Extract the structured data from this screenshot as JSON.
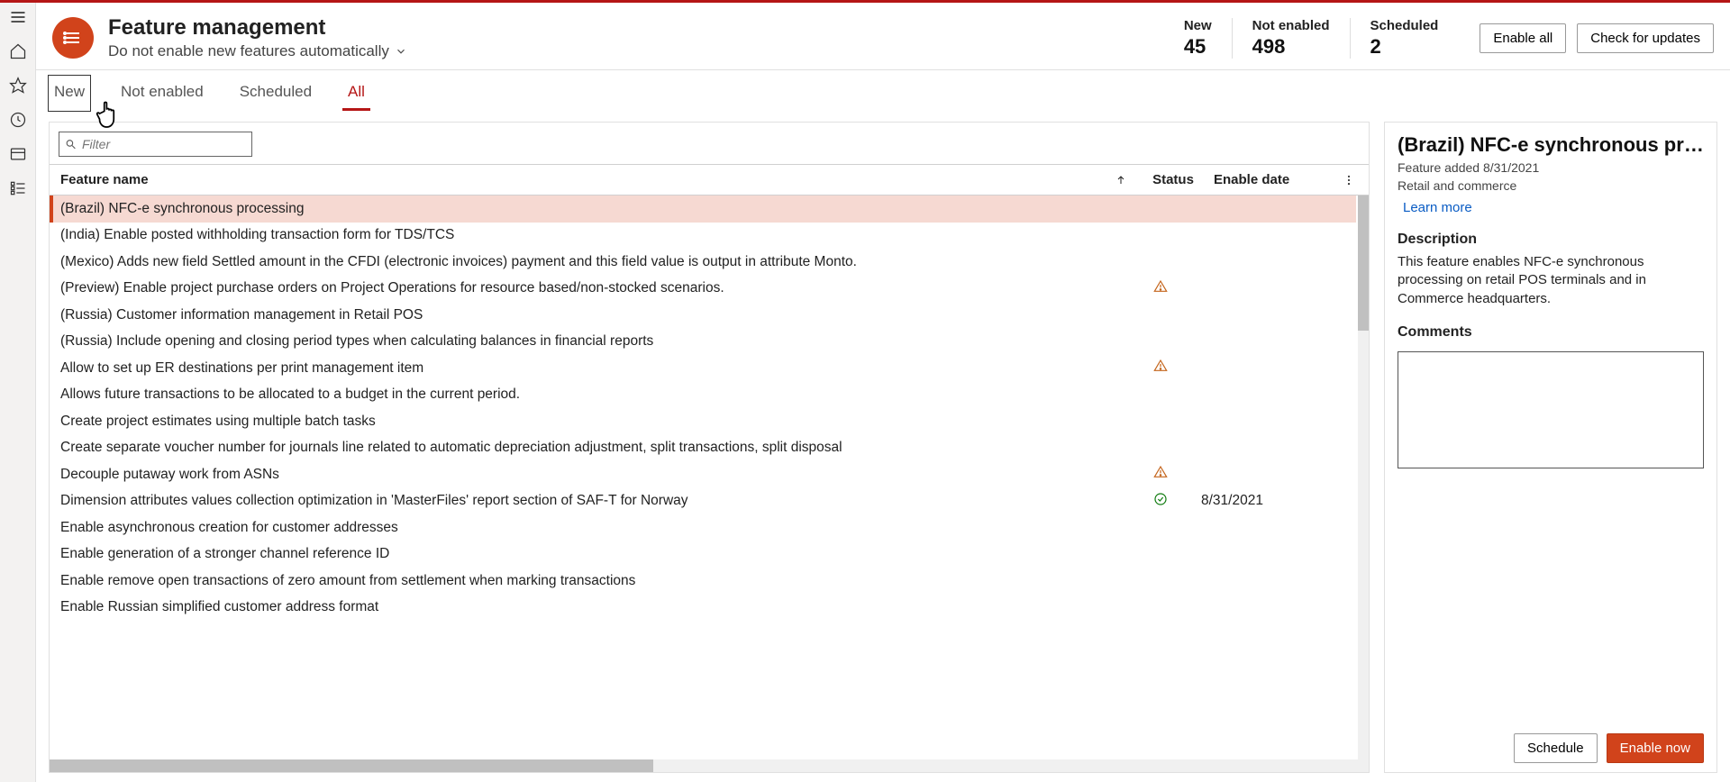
{
  "header": {
    "title": "Feature management",
    "subtitle": "Do not enable new features automatically",
    "metrics": [
      {
        "label": "New",
        "value": "45"
      },
      {
        "label": "Not enabled",
        "value": "498"
      },
      {
        "label": "Scheduled",
        "value": "2"
      }
    ],
    "actions": {
      "enable_all": "Enable all",
      "check_updates": "Check for updates"
    }
  },
  "tabs": {
    "new": "New",
    "not_enabled": "Not enabled",
    "scheduled": "Scheduled",
    "all": "All"
  },
  "filter": {
    "placeholder": "Filter"
  },
  "columns": {
    "name": "Feature name",
    "status": "Status",
    "date": "Enable date"
  },
  "rows": [
    {
      "name": "(Brazil) NFC-e synchronous processing",
      "status": "",
      "date": "",
      "selected": true
    },
    {
      "name": "(India) Enable posted withholding transaction form for TDS/TCS",
      "status": "",
      "date": ""
    },
    {
      "name": "(Mexico) Adds new field Settled amount in the CFDI (electronic invoices) payment and this field value is output in attribute Monto.",
      "status": "",
      "date": ""
    },
    {
      "name": "(Preview) Enable project purchase orders on Project Operations for resource based/non-stocked scenarios.",
      "status": "warn",
      "date": ""
    },
    {
      "name": "(Russia) Customer information management in Retail POS",
      "status": "",
      "date": ""
    },
    {
      "name": "(Russia) Include opening and closing period types when calculating balances in financial reports",
      "status": "",
      "date": ""
    },
    {
      "name": "Allow to set up ER destinations per print management item",
      "status": "warn",
      "date": ""
    },
    {
      "name": "Allows future transactions to be allocated to a budget in the current period.",
      "status": "",
      "date": ""
    },
    {
      "name": "Create project estimates using multiple batch tasks",
      "status": "",
      "date": ""
    },
    {
      "name": "Create separate voucher number for journals line related to automatic depreciation adjustment, split transactions, split disposal",
      "status": "",
      "date": ""
    },
    {
      "name": "Decouple putaway work from ASNs",
      "status": "warn",
      "date": ""
    },
    {
      "name": "Dimension attributes values collection optimization in 'MasterFiles' report section of SAF-T for Norway",
      "status": "ok",
      "date": "8/31/2021"
    },
    {
      "name": "Enable asynchronous creation for customer addresses",
      "status": "",
      "date": ""
    },
    {
      "name": "Enable generation of a stronger channel reference ID",
      "status": "",
      "date": ""
    },
    {
      "name": "Enable remove open transactions of zero amount from settlement when marking transactions",
      "status": "",
      "date": ""
    },
    {
      "name": "Enable Russian simplified customer address format",
      "status": "",
      "date": ""
    }
  ],
  "details": {
    "title": "(Brazil) NFC-e synchronous proce...",
    "added": "Feature added 8/31/2021",
    "module": "Retail and commerce",
    "learn_more": "Learn more",
    "desc_heading": "Description",
    "description": "This feature enables NFC-e synchronous processing on retail POS terminals and in Commerce headquarters.",
    "comments_heading": "Comments",
    "schedule": "Schedule",
    "enable_now": "Enable now"
  }
}
